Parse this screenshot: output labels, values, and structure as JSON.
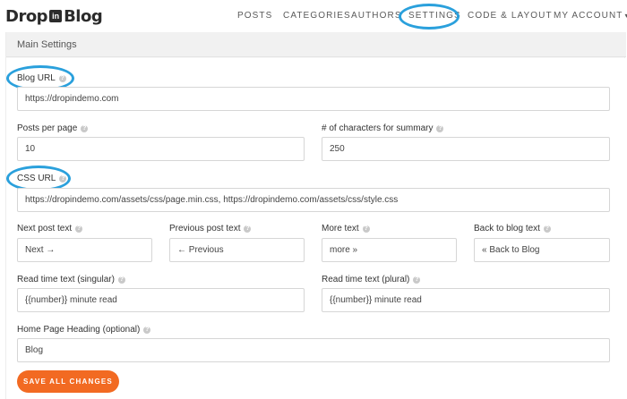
{
  "brand": {
    "logo_left": "Drop",
    "logo_badge": "in",
    "logo_right": "Blog"
  },
  "nav": {
    "items": [
      {
        "label": "POSTS"
      },
      {
        "label": "CATEGORIES"
      },
      {
        "label": "AUTHORS"
      },
      {
        "label": "SETTINGS"
      },
      {
        "label": "CODE & LAYOUT"
      },
      {
        "label": "MY ACCOUNT"
      }
    ],
    "account_arrow": "▾",
    "active": "SETTINGS"
  },
  "section": {
    "title": "Main Settings"
  },
  "form": {
    "blog_url": {
      "label": "Blog URL",
      "value": "https://dropindemo.com"
    },
    "posts_per_page": {
      "label": "Posts per page",
      "value": "10"
    },
    "summary_chars": {
      "label": "# of characters for summary",
      "value": "250"
    },
    "css_url": {
      "label": "CSS URL",
      "value": "https://dropindemo.com/assets/css/page.min.css, https://dropindemo.com/assets/css/style.css"
    },
    "next_post": {
      "label": "Next post text",
      "value": "Next →"
    },
    "previous_post": {
      "label": "Previous post text",
      "value": "← Previous"
    },
    "more_text": {
      "label": "More text",
      "value": "more »"
    },
    "back_to_blog": {
      "label": "Back to blog text",
      "value": "« Back to Blog"
    },
    "read_time_singular": {
      "label": "Read time text (singular)",
      "value": "{{number}} minute read"
    },
    "read_time_plural": {
      "label": "Read time text (plural)",
      "value": "{{number}} minute read"
    },
    "home_heading": {
      "label": "Home Page Heading (optional)",
      "value": "Blog"
    }
  },
  "actions": {
    "save_label": "SAVE ALL CHANGES"
  },
  "colors": {
    "accent": "#f26a22",
    "highlight": "#2aa0dc"
  },
  "icons": {
    "help": "question-circle-icon"
  }
}
